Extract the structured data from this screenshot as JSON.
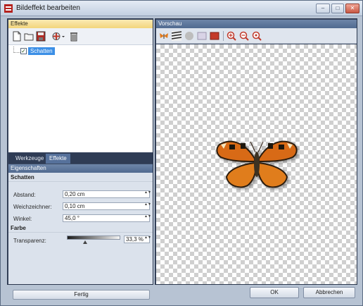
{
  "window": {
    "title": "Bildeffekt bearbeiten",
    "controls": {
      "minimize": "–",
      "maximize": "□",
      "close": "✕"
    }
  },
  "effects_panel": {
    "title": "Effekte",
    "toolbar_icons": [
      "new-file-icon",
      "open-folder-icon",
      "save-disk-icon",
      "add-effect-icon",
      "delete-trash-icon"
    ],
    "tree_items": [
      {
        "label": "Schatten",
        "checked": true,
        "check_glyph": "✓"
      }
    ]
  },
  "tabs": [
    {
      "label": "Werkzeuge",
      "active": false
    },
    {
      "label": "Effekte",
      "active": true
    }
  ],
  "properties": {
    "title": "Eigenschaften",
    "section_shadow": "Schatten",
    "distance_label": "Abstand:",
    "distance_value": "0,20 cm",
    "blur_label": "Weichzeichner:",
    "blur_value": "0,10 cm",
    "angle_label": "Winkel:",
    "angle_value": "45,0 °",
    "section_color": "Farbe",
    "transparency_label": "Transparenz:",
    "transparency_value": "33,3 %",
    "transparency_fraction": 0.333,
    "spin_arrows": "▲▼",
    "done_button": "Fertig"
  },
  "preview": {
    "title": "Vorschau",
    "toolbar_icons": [
      "butterfly-image-icon",
      "zebra-pattern-icon",
      "gray-circle-icon",
      "light-rect-icon",
      "red-rect-icon",
      "zoom-in-icon",
      "zoom-out-icon",
      "zoom-reset-icon"
    ]
  },
  "footer": {
    "ok": "OK",
    "cancel": "Abbrechen"
  },
  "colors": {
    "accent_selection": "#3c8fe6",
    "panel_header": "#56719b",
    "highlight_header": "#f2d57c"
  }
}
